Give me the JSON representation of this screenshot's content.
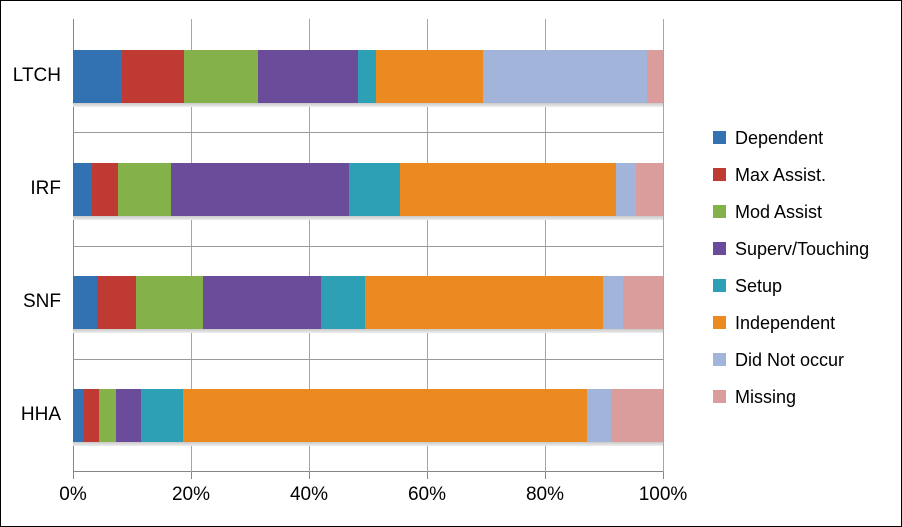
{
  "chart_data": {
    "type": "bar",
    "orientation": "horizontal",
    "stacked": true,
    "stack_mode": "percent",
    "title": "",
    "xlabel": "",
    "ylabel": "",
    "xlim": [
      0,
      100
    ],
    "xticks": [
      0,
      20,
      40,
      60,
      80,
      100
    ],
    "xtick_labels": [
      "0%",
      "20%",
      "40%",
      "60%",
      "80%",
      "100%"
    ],
    "grid": true,
    "legend_position": "right",
    "categories": [
      "LTCH",
      "IRF",
      "SNF",
      "HHA"
    ],
    "series": [
      {
        "name": "Dependent",
        "color": "#3372B2",
        "values": [
          8.3,
          3.2,
          4.1,
          1.9
        ]
      },
      {
        "name": "Max Assist.",
        "color": "#BE3A33",
        "values": [
          10.5,
          4.4,
          6.6,
          2.5
        ]
      },
      {
        "name": "Mod Assist",
        "color": "#85B14B",
        "values": [
          12.5,
          9.0,
          11.3,
          2.9
        ]
      },
      {
        "name": "Superv/Touching",
        "color": "#6B4C9A",
        "values": [
          17.0,
          30.2,
          20.0,
          4.2
        ]
      },
      {
        "name": "Setup",
        "color": "#2EA0B5",
        "values": [
          3.1,
          8.6,
          7.5,
          7.1
        ]
      },
      {
        "name": "Independent",
        "color": "#EA8A21",
        "values": [
          18.1,
          36.6,
          40.3,
          68.5
        ]
      },
      {
        "name": "Did Not occur",
        "color": "#A2B4DA",
        "values": [
          27.8,
          3.4,
          3.4,
          4.1
        ]
      },
      {
        "name": "Missing",
        "color": "#DB9C9C",
        "values": [
          2.7,
          4.6,
          6.8,
          8.8
        ]
      }
    ]
  },
  "axis": {
    "y_categories": [
      "LTCH",
      "IRF",
      "SNF",
      "HHA"
    ],
    "x_tick_labels": [
      "0%",
      "20%",
      "40%",
      "60%",
      "80%",
      "100%"
    ]
  },
  "legend": {
    "entries": [
      {
        "label": "Dependent",
        "color": "#3372B2",
        "icon": "legend-swatch-icon"
      },
      {
        "label": "Max Assist.",
        "color": "#BE3A33",
        "icon": "legend-swatch-icon"
      },
      {
        "label": "Mod Assist",
        "color": "#85B14B",
        "icon": "legend-swatch-icon"
      },
      {
        "label": "Superv/Touching",
        "color": "#6B4C9A",
        "icon": "legend-swatch-icon"
      },
      {
        "label": "Setup",
        "color": "#2EA0B5",
        "icon": "legend-swatch-icon"
      },
      {
        "label": "Independent",
        "color": "#EA8A21",
        "icon": "legend-swatch-icon"
      },
      {
        "label": "Did Not occur",
        "color": "#A2B4DA",
        "icon": "legend-swatch-icon"
      },
      {
        "label": "Missing",
        "color": "#DB9C9C",
        "icon": "legend-swatch-icon"
      }
    ]
  }
}
